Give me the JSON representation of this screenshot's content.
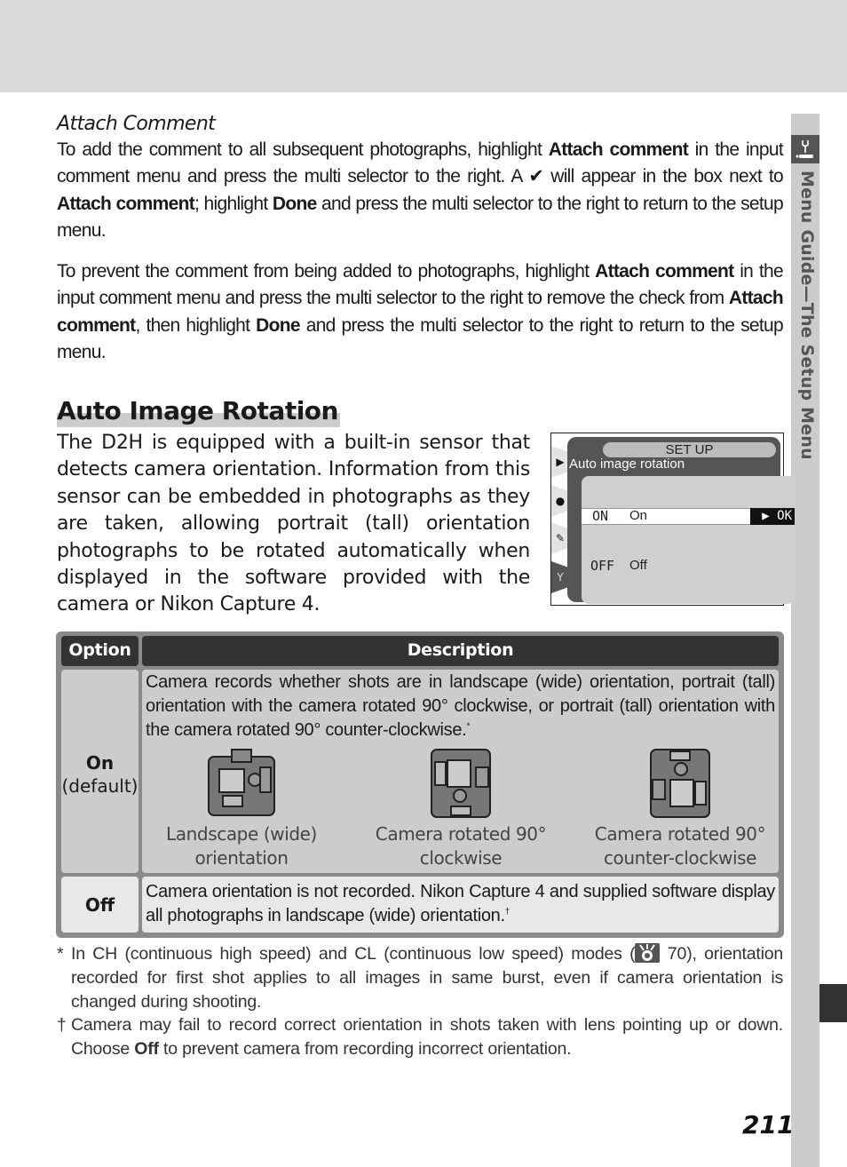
{
  "page": {
    "number": "211",
    "side_tab_label": "Menu Guide—The Setup Menu",
    "colors": {
      "top_band": "#d9d9d9",
      "side_strip": "#cccccc",
      "table_header": "#333333",
      "heading_underline": "#cccccc"
    }
  },
  "attach_comment": {
    "heading": "Attach Comment",
    "para1": {
      "t1": "To add the comment to all subsequent photographs, highlight ",
      "b1": "Attach comment",
      "t2": " in the input comment menu and press the multi selector to the right. A ✔ will appear in the box next to ",
      "b2": "Attach comment",
      "t3": "; highlight ",
      "b3": "Done",
      "t4": " and press the multi selector to the right to return to the setup menu."
    },
    "para2": {
      "t1": "To prevent the comment from being added to photographs, highlight ",
      "b1": "Attach comment",
      "t2": " in the input comment menu and press the multi selector to the right to remove the check from ",
      "b2": "Attach comment",
      "t3": ", then highlight ",
      "b3": "Done",
      "t4": " and press the multi selector to the right to return to the setup menu."
    }
  },
  "auto_image_rotation": {
    "heading": "Auto Image Rotation",
    "intro": "The D2H is equipped with a built-in sensor that detects camera orientation.  Information from this sensor can be embedded in photographs as they are taken, allowing portrait (tall) orientation photographs to be rotated automatically when displayed in the software provided with the camera or Nikon Capture 4."
  },
  "camera_screen": {
    "menu_title": "SET UP",
    "item_title": "Auto image rotation",
    "options": [
      {
        "code": "ON",
        "label": "On",
        "selected": true,
        "confirm": "▶ OK"
      },
      {
        "code": "OFF",
        "label": "Off",
        "selected": false
      }
    ],
    "tabs": [
      "playback-icon",
      "camera-icon",
      "pencil-icon",
      "wrench-icon"
    ]
  },
  "table": {
    "headers": {
      "option": "Option",
      "description": "Description"
    },
    "rows": [
      {
        "option": "On",
        "option_note": "(default)",
        "description": "Camera records whether shots are in landscape (wide) orientation, portrait (tall) orientation with the camera rotated 90° clockwise, or portrait (tall) orientation with the camera rotated 90° counter-clockwise.",
        "description_mark": "*",
        "figures": [
          {
            "caption_line1": "Landscape (wide)",
            "caption_line2": "orientation"
          },
          {
            "caption_line1": "Camera rotated 90°",
            "caption_line2": "clockwise"
          },
          {
            "caption_line1": "Camera rotated 90°",
            "caption_line2": "counter-clockwise"
          }
        ]
      },
      {
        "option": "Off",
        "description": "Camera orientation is not recorded.  Nikon Capture 4 and supplied software display all photographs in landscape (wide) orientation.",
        "description_mark": "†"
      }
    ]
  },
  "footnotes": [
    {
      "mark": "*",
      "t1": "In ",
      "ch": "CH",
      "t2": " (continuous high speed) and ",
      "cl": "CL",
      "t3": " (continuous low speed) modes (",
      "ref": "70",
      "t4": "), orientation recorded for first shot applies to all images in same burst, even if camera orientation is changed during shooting."
    },
    {
      "mark": "†",
      "t1": "Camera may fail to record correct orientation in shots taken with lens pointing up or down.  Choose ",
      "b1": "Off",
      "t2": " to prevent camera from recording incorrect orientation."
    }
  ]
}
